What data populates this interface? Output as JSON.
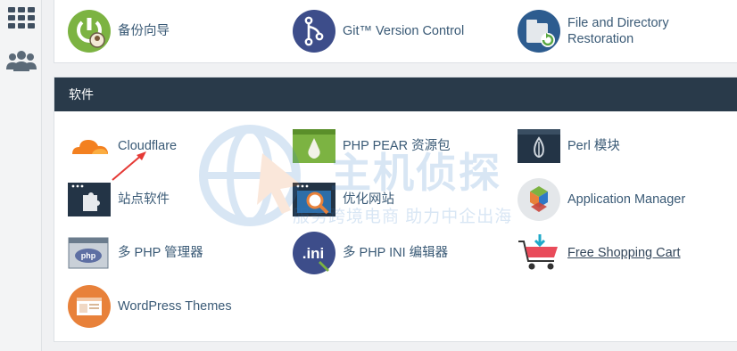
{
  "sidebar": {
    "apps_icon": "grid-icon",
    "users_icon": "users-icon"
  },
  "files_row": [
    {
      "label": "备份向导",
      "icon": "backup-wizard-icon"
    },
    {
      "label": "Git™ Version Control",
      "icon": "git-icon"
    },
    {
      "label": "File and Directory Restoration",
      "icon": "restore-icon"
    }
  ],
  "software": {
    "title": "软件",
    "items": [
      {
        "label": "Cloudflare",
        "icon": "cloudflare-icon"
      },
      {
        "label": "PHP PEAR 资源包",
        "icon": "php-pear-icon"
      },
      {
        "label": "Perl 模块",
        "icon": "perl-icon"
      },
      {
        "label": "站点软件",
        "icon": "site-software-icon"
      },
      {
        "label": "优化网站",
        "icon": "optimize-icon"
      },
      {
        "label": "Application Manager",
        "icon": "app-manager-icon"
      },
      {
        "label": "多 PHP 管理器",
        "icon": "multiphp-icon"
      },
      {
        "label": "多 PHP INI 编辑器",
        "icon": "php-ini-icon"
      },
      {
        "label": "Free Shopping Cart",
        "icon": "shopping-cart-icon"
      },
      {
        "label": "WordPress Themes",
        "icon": "wordpress-themes-icon"
      }
    ]
  },
  "watermark": {
    "text": "主机侦探",
    "sub": "服务跨境电商 助力中企出海"
  },
  "colors": {
    "header_bg": "#293a4a",
    "label": "#3a5a76",
    "accent_orange": "#e8813a",
    "accent_blue": "#2f78c6"
  }
}
